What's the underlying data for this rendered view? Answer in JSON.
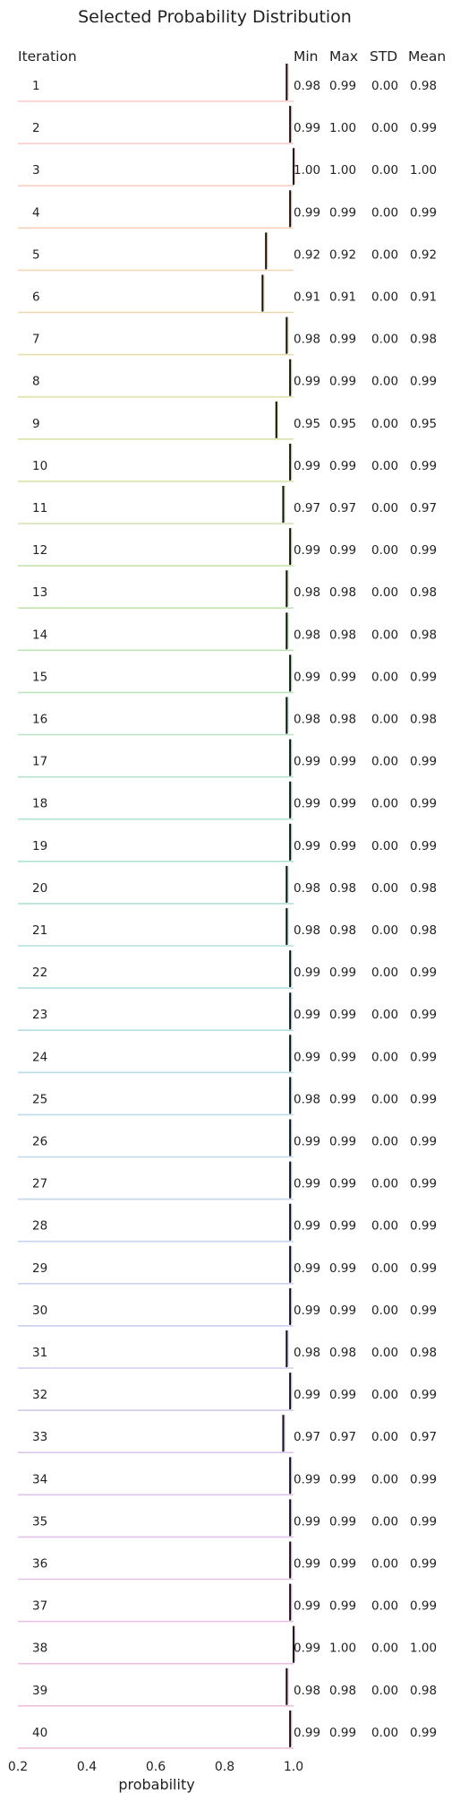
{
  "chart_data": {
    "type": "ridgeline",
    "title": "Selected Probability Distribution",
    "xlabel": "probability",
    "xlim": [
      0.2,
      1.0
    ],
    "x_ticks": [
      "0.2",
      "0.4",
      "0.6",
      "0.8",
      "1.0"
    ],
    "columns": [
      "Iteration",
      "Min",
      "Max",
      "STD",
      "Mean"
    ],
    "rows": [
      {
        "iteration": "1",
        "min": "0.98",
        "max": "0.99",
        "std": "0.00",
        "mean": "0.98",
        "color": "#f9c9c9"
      },
      {
        "iteration": "2",
        "min": "0.99",
        "max": "1.00",
        "std": "0.00",
        "mean": "0.99",
        "color": "#f9ccc8"
      },
      {
        "iteration": "3",
        "min": "1.00",
        "max": "1.00",
        "std": "0.00",
        "mean": "1.00",
        "color": "#f9cfc3"
      },
      {
        "iteration": "4",
        "min": "0.99",
        "max": "0.99",
        "std": "0.00",
        "mean": "0.99",
        "color": "#f6d2bd"
      },
      {
        "iteration": "5",
        "min": "0.92",
        "max": "0.92",
        "std": "0.00",
        "mean": "0.92",
        "color": "#f2d6b7"
      },
      {
        "iteration": "6",
        "min": "0.91",
        "max": "0.91",
        "std": "0.00",
        "mean": "0.91",
        "color": "#eddab2"
      },
      {
        "iteration": "7",
        "min": "0.98",
        "max": "0.99",
        "std": "0.00",
        "mean": "0.98",
        "color": "#e7ddae"
      },
      {
        "iteration": "8",
        "min": "0.99",
        "max": "0.99",
        "std": "0.00",
        "mean": "0.99",
        "color": "#e1dfab"
      },
      {
        "iteration": "9",
        "min": "0.95",
        "max": "0.95",
        "std": "0.00",
        "mean": "0.95",
        "color": "#dbe1aa"
      },
      {
        "iteration": "10",
        "min": "0.99",
        "max": "0.99",
        "std": "0.00",
        "mean": "0.99",
        "color": "#d5e2aa"
      },
      {
        "iteration": "11",
        "min": "0.97",
        "max": "0.97",
        "std": "0.00",
        "mean": "0.97",
        "color": "#cfe3ab"
      },
      {
        "iteration": "12",
        "min": "0.99",
        "max": "0.99",
        "std": "0.00",
        "mean": "0.99",
        "color": "#c9e4ae"
      },
      {
        "iteration": "13",
        "min": "0.98",
        "max": "0.98",
        "std": "0.00",
        "mean": "0.98",
        "color": "#c4e4b2"
      },
      {
        "iteration": "14",
        "min": "0.98",
        "max": "0.98",
        "std": "0.00",
        "mean": "0.98",
        "color": "#bfe5b7"
      },
      {
        "iteration": "15",
        "min": "0.99",
        "max": "0.99",
        "std": "0.00",
        "mean": "0.99",
        "color": "#bbe5bd"
      },
      {
        "iteration": "16",
        "min": "0.98",
        "max": "0.98",
        "std": "0.00",
        "mean": "0.98",
        "color": "#b7e5c3"
      },
      {
        "iteration": "17",
        "min": "0.99",
        "max": "0.99",
        "std": "0.00",
        "mean": "0.99",
        "color": "#b4e4c9"
      },
      {
        "iteration": "18",
        "min": "0.99",
        "max": "0.99",
        "std": "0.00",
        "mean": "0.99",
        "color": "#b2e4cf"
      },
      {
        "iteration": "19",
        "min": "0.99",
        "max": "0.99",
        "std": "0.00",
        "mean": "0.99",
        "color": "#b1e3d5"
      },
      {
        "iteration": "20",
        "min": "0.98",
        "max": "0.98",
        "std": "0.00",
        "mean": "0.98",
        "color": "#b1e2da"
      },
      {
        "iteration": "21",
        "min": "0.98",
        "max": "0.98",
        "std": "0.00",
        "mean": "0.98",
        "color": "#b2e1de"
      },
      {
        "iteration": "22",
        "min": "0.99",
        "max": "0.99",
        "std": "0.00",
        "mean": "0.99",
        "color": "#b3e0e2"
      },
      {
        "iteration": "23",
        "min": "0.99",
        "max": "0.99",
        "std": "0.00",
        "mean": "0.99",
        "color": "#b5dfe6"
      },
      {
        "iteration": "24",
        "min": "0.99",
        "max": "0.99",
        "std": "0.00",
        "mean": "0.99",
        "color": "#b8dde9"
      },
      {
        "iteration": "25",
        "min": "0.98",
        "max": "0.99",
        "std": "0.00",
        "mean": "0.99",
        "color": "#bbdbec"
      },
      {
        "iteration": "26",
        "min": "0.99",
        "max": "0.99",
        "std": "0.00",
        "mean": "0.99",
        "color": "#bed9ee"
      },
      {
        "iteration": "27",
        "min": "0.99",
        "max": "0.99",
        "std": "0.00",
        "mean": "0.99",
        "color": "#c2d7f0"
      },
      {
        "iteration": "28",
        "min": "0.99",
        "max": "0.99",
        "std": "0.00",
        "mean": "0.99",
        "color": "#c6d4f1"
      },
      {
        "iteration": "29",
        "min": "0.99",
        "max": "0.99",
        "std": "0.00",
        "mean": "0.99",
        "color": "#cad2f2"
      },
      {
        "iteration": "30",
        "min": "0.99",
        "max": "0.99",
        "std": "0.00",
        "mean": "0.99",
        "color": "#cecff2"
      },
      {
        "iteration": "31",
        "min": "0.98",
        "max": "0.98",
        "std": "0.00",
        "mean": "0.98",
        "color": "#d2ccf2"
      },
      {
        "iteration": "32",
        "min": "0.99",
        "max": "0.99",
        "std": "0.00",
        "mean": "0.99",
        "color": "#d6caf1"
      },
      {
        "iteration": "33",
        "min": "0.97",
        "max": "0.97",
        "std": "0.00",
        "mean": "0.97",
        "color": "#dac7f0"
      },
      {
        "iteration": "34",
        "min": "0.99",
        "max": "0.99",
        "std": "0.00",
        "mean": "0.99",
        "color": "#dec5ee"
      },
      {
        "iteration": "35",
        "min": "0.99",
        "max": "0.99",
        "std": "0.00",
        "mean": "0.99",
        "color": "#e2c3ec"
      },
      {
        "iteration": "36",
        "min": "0.99",
        "max": "0.99",
        "std": "0.00",
        "mean": "0.99",
        "color": "#e6c2e9"
      },
      {
        "iteration": "37",
        "min": "0.99",
        "max": "0.99",
        "std": "0.00",
        "mean": "0.99",
        "color": "#e9c1e5"
      },
      {
        "iteration": "38",
        "min": "0.99",
        "max": "1.00",
        "std": "0.00",
        "mean": "1.00",
        "color": "#ecc0e1"
      },
      {
        "iteration": "39",
        "min": "0.98",
        "max": "0.98",
        "std": "0.00",
        "mean": "0.98",
        "color": "#efc0dc"
      },
      {
        "iteration": "40",
        "min": "0.99",
        "max": "0.99",
        "std": "0.00",
        "mean": "0.99",
        "color": "#f1c1d7"
      }
    ]
  }
}
